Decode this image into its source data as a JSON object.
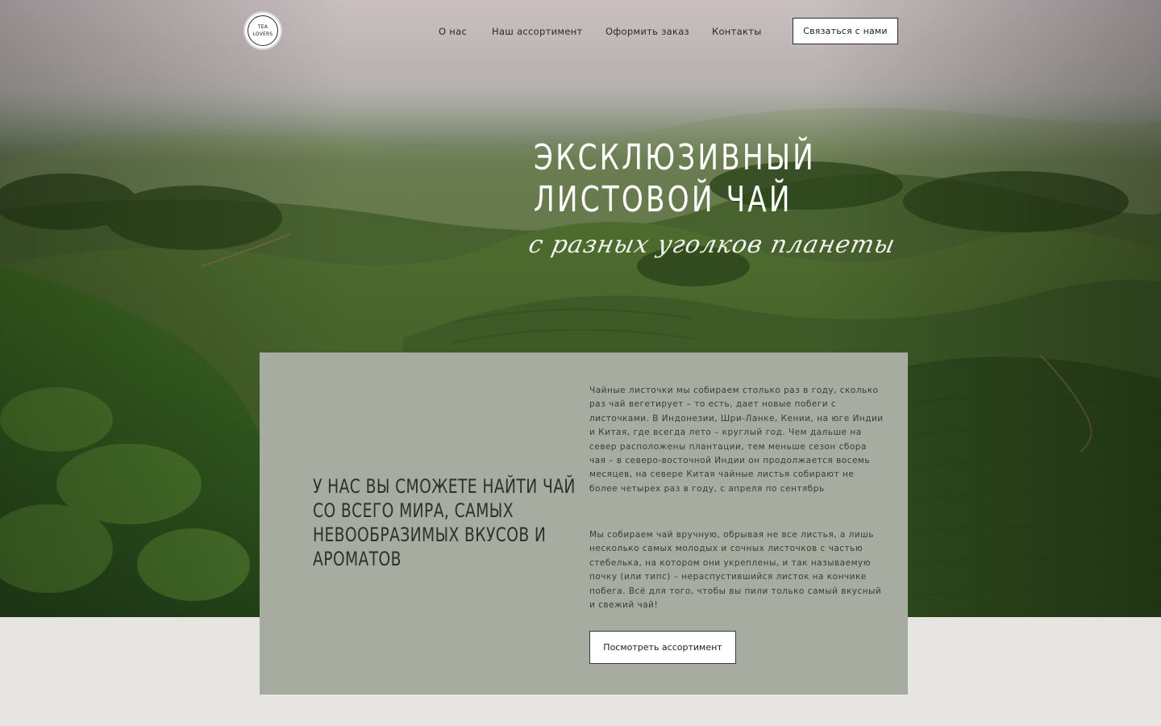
{
  "brand": {
    "logo_line1": "TEA",
    "logo_line2": "LOVERS"
  },
  "nav": {
    "items": [
      {
        "label": "О нас"
      },
      {
        "label": "Наш ассортимент"
      },
      {
        "label": "Оформить заказ"
      },
      {
        "label": "Контакты"
      }
    ],
    "cta_label": "Связаться с нами"
  },
  "hero": {
    "title_line1": "ЭКСКЛЮЗИВНЫЙ",
    "title_line2": "ЛИСТОВОЙ ЧАЙ",
    "script_subtitle": "с разных уголков планеты"
  },
  "about": {
    "heading": "У НАС ВЫ СМОЖЕТЕ НАЙТИ ЧАЙ СО ВСЕГО МИРА, САМЫХ НЕВООБРАЗИМЫХ ВКУСОВ И АРОМАТОВ",
    "paragraph1": "Чайные листочки мы собираем столько раз в году, сколько раз чай вегетирует – то есть, дает новые побеги с листочками. В Индонезии, Шри-Ланке, Кении, на юге Индии и Китая, где всегда лето – круглый год. Чем дальше на север расположены плантации, тем меньше сезон сбора чая – в северо-восточной Индии он продолжается восемь месяцев, на севере Китая чайные листья собирают не более четырех раз в году, с апреля по сентябрь",
    "paragraph2": "Мы собираем чай вручную, обрывая не все листья, а лишь несколько самых молодых и сочных листочков с частью стебелька, на котором они укреплены, и так называемую почку (или типс) – нераспустившийся листок на кончике побега. Всё для того, чтобы вы пили только самый вкусный и свежий чай!",
    "button_label": "Посмотреть ассортимент"
  },
  "colors": {
    "panel_bg": "#a6aca0",
    "page_bg": "#e6e5e1",
    "text_dark": "#2f2f2d"
  }
}
